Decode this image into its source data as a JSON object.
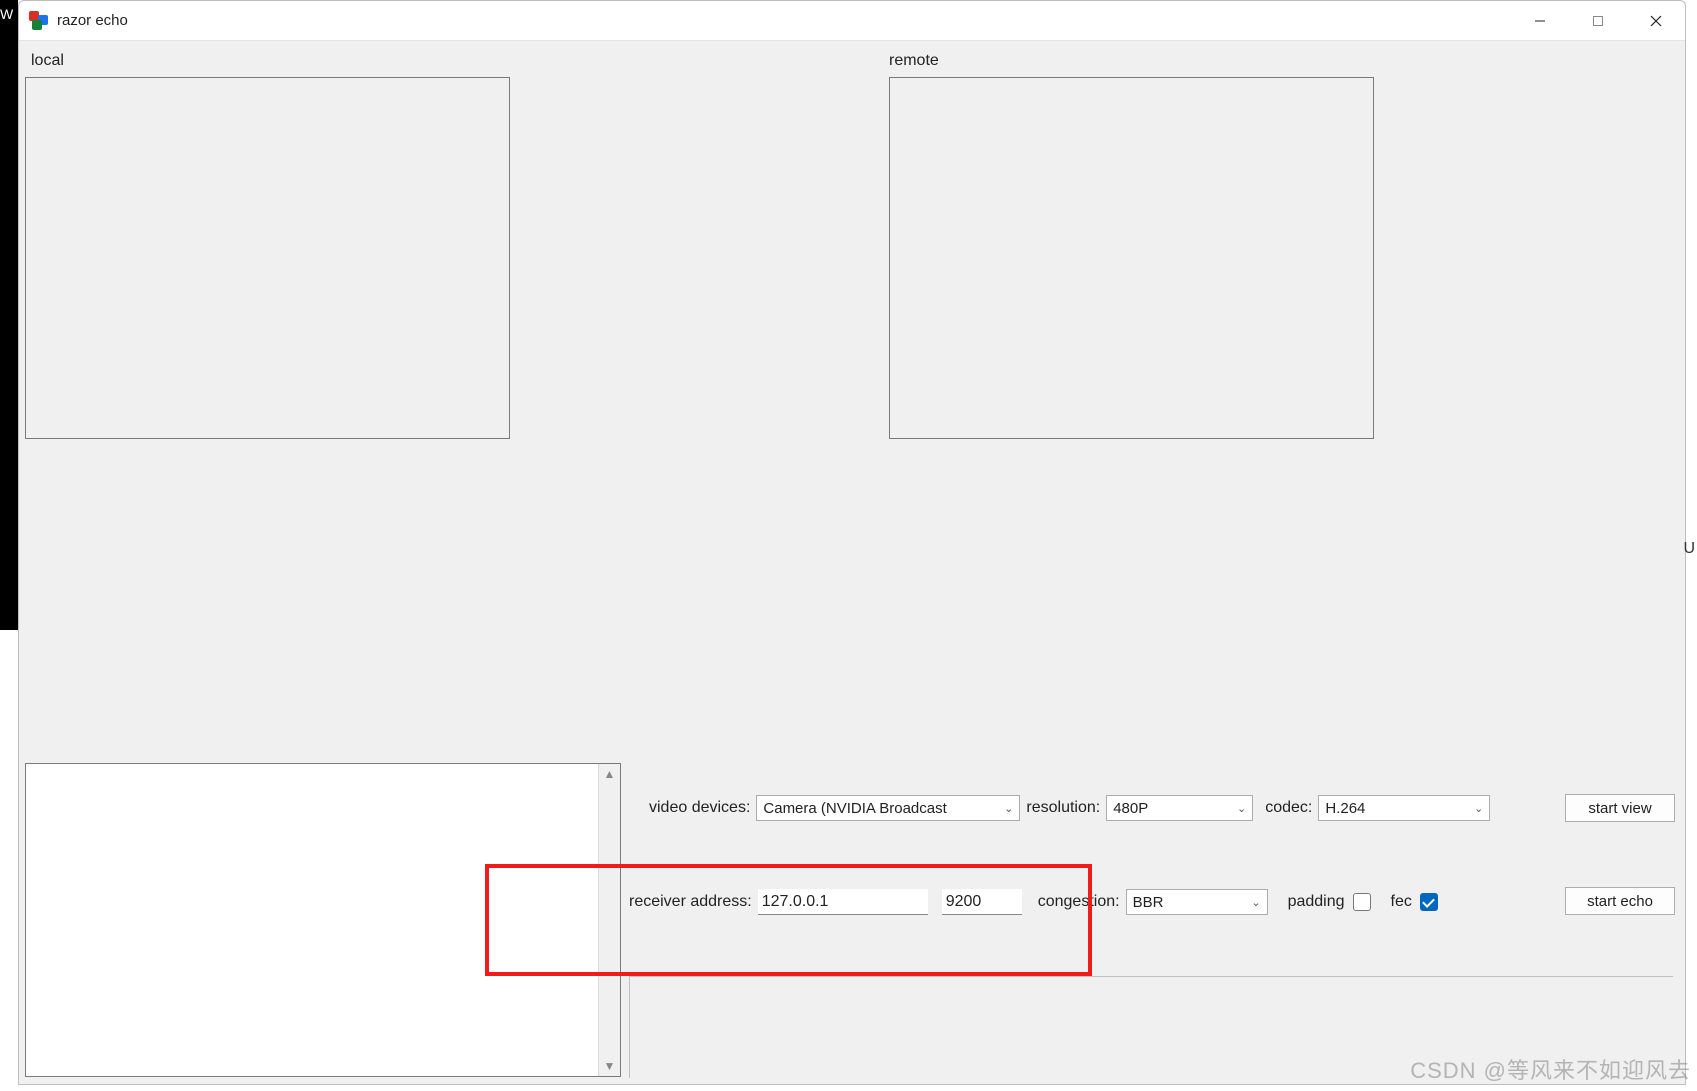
{
  "window": {
    "title": "razor echo"
  },
  "panels": {
    "local_label": "local",
    "remote_label": "remote"
  },
  "row1": {
    "video_devices_label": "video devices:",
    "video_device_value": "Camera (NVIDIA Broadcast",
    "resolution_label": "resolution:",
    "resolution_value": "480P",
    "codec_label": "codec:",
    "codec_value": "H.264",
    "start_view_label": "start view"
  },
  "row2": {
    "receiver_address_label": "receiver address:",
    "ip_value": "127.0.0.1",
    "port_value": "9200",
    "congestion_label": "congestion:",
    "congestion_value": "BBR",
    "padding_label": "padding",
    "fec_label": "fec",
    "padding_checked": false,
    "fec_checked": true,
    "start_echo_label": "start echo"
  },
  "watermark": "CSDN @等风来不如迎风去",
  "stray": {
    "left_w": "W",
    "right_u": "U"
  }
}
